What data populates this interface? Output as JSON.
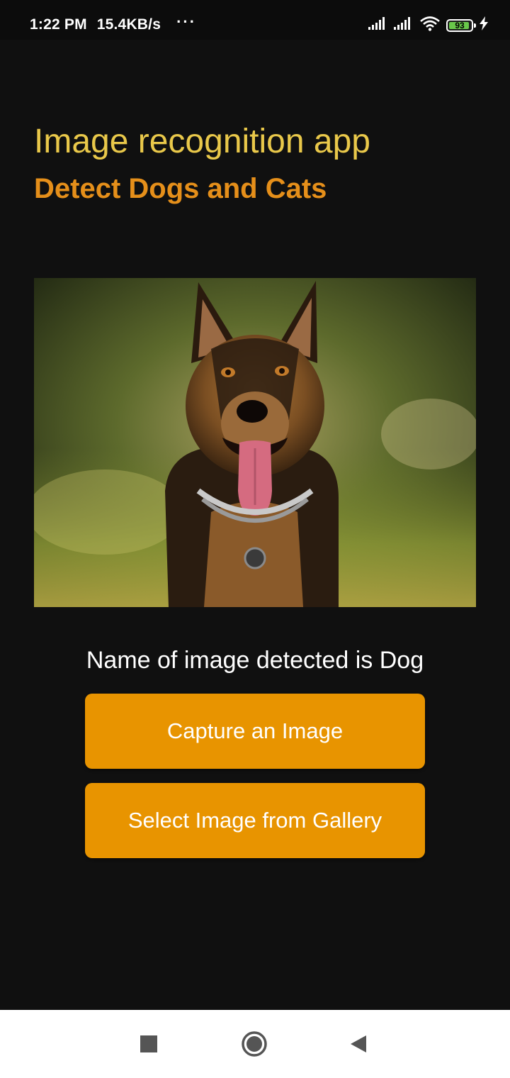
{
  "status_bar": {
    "time": "1:22 PM",
    "speed": "15.4KB/s",
    "dots": "···",
    "battery": "93",
    "battery_level": 0.93
  },
  "header": {
    "title": "Image recognition app",
    "subtitle": "Detect Dogs and Cats"
  },
  "photo": {
    "subject": "german-shepherd-dog"
  },
  "result": {
    "text": "Name of image detected is Dog"
  },
  "buttons": {
    "capture_label": "Capture an Image",
    "gallery_label": "Select Image from Gallery"
  },
  "colors": {
    "background": "#101010",
    "title": "#e9c84a",
    "subtitle": "#e58f1a",
    "button": "#e89400"
  },
  "nav_bar": {
    "icons": [
      "square-recent-icon",
      "circle-home-icon",
      "triangle-back-icon"
    ]
  }
}
